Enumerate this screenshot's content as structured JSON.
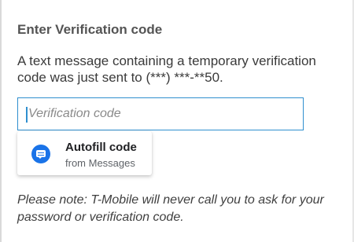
{
  "form": {
    "heading": "Enter Verification code",
    "message": "A text message containing a temporary verification code was just sent to (***) ***-**50.",
    "input": {
      "placeholder": "Verification code",
      "value": ""
    },
    "note": "Please note: T-Mobile will never call you to ask for your password or verification code."
  },
  "autofill": {
    "title": "Autofill code",
    "subtitle": "from Messages",
    "icon": "messages-icon",
    "icon_color": "#1a73e8"
  },
  "colors": {
    "input_border": "#2f8fcf"
  }
}
